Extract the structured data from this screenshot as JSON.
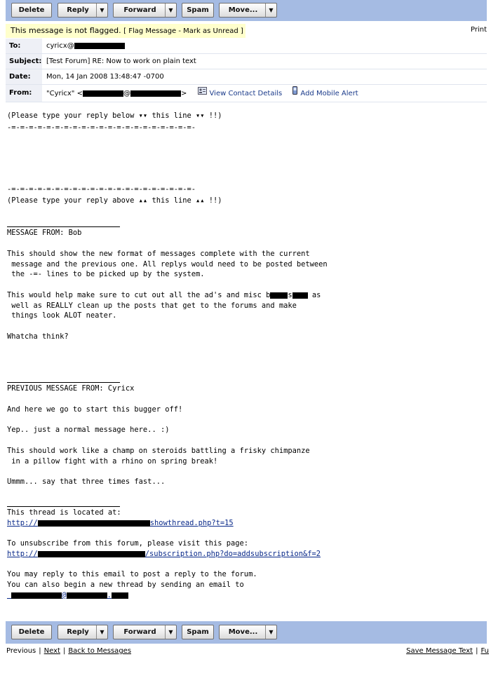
{
  "toolbar": {
    "delete": "Delete",
    "reply": "Reply",
    "forward": "Forward",
    "spam": "Spam",
    "move": "Move..."
  },
  "flag": {
    "status": "This message is not flagged.",
    "flag_message": "Flag Message",
    "mark_unread": "Mark as Unread"
  },
  "print_label": "Print",
  "headers": {
    "to_label": "To:",
    "to_value": "cyricx@",
    "subject_label": "Subject:",
    "subject_value": "[Test Forum] RE: Now to work on plain text",
    "date_label": "Date:",
    "date_value": "Mon, 14 Jan 2008 13:48:47 -0700",
    "from_label": "From:",
    "from_name": "\"Cyricx\" <",
    "from_at": "@",
    "from_end": ">",
    "view_contact": "View Contact Details",
    "add_mobile": "Add Mobile Alert"
  },
  "body": {
    "l1": "(Please type your reply below ▾▾ this line ▾▾ !!)",
    "l2": "-=-=-=-=-=-=-=-=-=-=-=-=-=-=-=-=-=-=-=-=-=-",
    "l3": "-=-=-=-=-=-=-=-=-=-=-=-=-=-=-=-=-=-=-=-=-=-",
    "l4": "(Please type your reply above ▴▴ this line ▴▴ !!)",
    "l5": "MESSAGE FROM: Bob",
    "l6": "This should show the new format of messages complete with the current",
    "l7": " message and the previous one. All replys would need to be posted between",
    "l8": " the -=- lines to be picked up by the system.",
    "l9a": "This would help make sure to cut out all the ad's and misc b",
    "l9b": "s",
    "l9c": " as",
    "l10": " well as REALLY clean up the posts that get to the forums and make",
    "l11": " things look ALOT neater.",
    "l12": "Whatcha think?",
    "l13": "PREVIOUS MESSAGE FROM: Cyricx",
    "l14": "And here we go to start this bugger off!",
    "l15": "Yep.. just a normal message here.. :)",
    "l16": "This should work like a champ on steroids battling a frisky chimpanze",
    "l17": " in a pillow fight with a rhino on spring break!",
    "l18": "Ummm... say that three times fast...",
    "l19": "This thread is located at:",
    "l20a": "http://",
    "l20b": "showthread.php?t=15",
    "l21": "To unsubscribe from this forum, please visit this page:",
    "l22a": "http://",
    "l22b": "/subscription.php?do=addsubscription&f=2",
    "l23": "You may reply to this email to post a reply to the forum.",
    "l24": "You can also begin a new thread by sending an email to",
    "l25a": "@",
    "l25b": "."
  },
  "footer": {
    "previous": "Previous",
    "next": "Next",
    "back": "Back to Messages",
    "save": "Save Message Text",
    "full": "Fu"
  }
}
